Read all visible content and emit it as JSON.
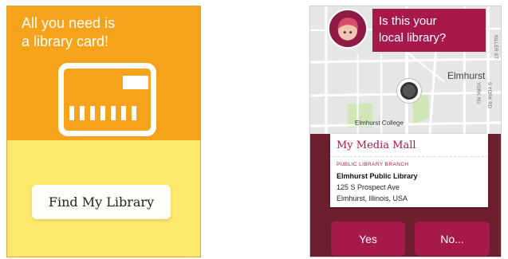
{
  "left_panel": {
    "headline_line1": "All you need is",
    "headline_line2": "a library card!",
    "find_button_label": "Find My Library",
    "colors": {
      "top": "#f7a21b",
      "bottom": "#fde86b"
    }
  },
  "right_panel": {
    "prompt_line1": "Is this your",
    "prompt_line2": "local library?",
    "map": {
      "city_label": "Elmhurst",
      "college_label": "Elmhurst College",
      "street_labels": [
        "YORK RD",
        "S YORK RD",
        "KILLER ST"
      ]
    },
    "library_card": {
      "title": "My Media Mall",
      "type": "PUBLIC LIBRARY BRANCH",
      "name": "Elmhurst Public Library",
      "address": "125 S Prospect Ave",
      "city": "Elmhurst, Illinois, USA"
    },
    "yes_label": "Yes",
    "no_label": "No...",
    "colors": {
      "accent": "#a8194b",
      "dark": "#6d1e2f"
    }
  }
}
